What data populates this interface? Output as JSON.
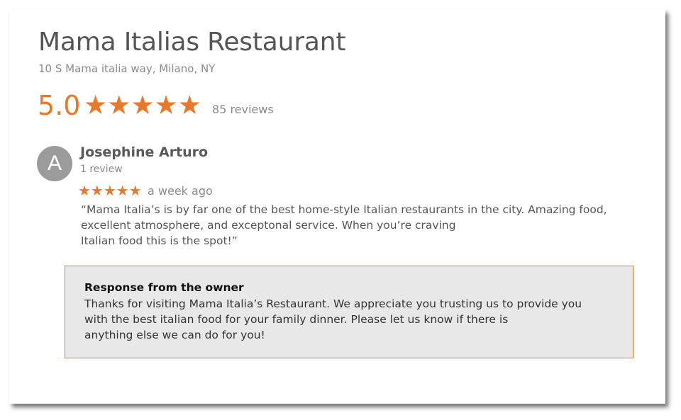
{
  "business": {
    "name": "Mama Italias Restaurant",
    "address": "10 S Mama italia way, Milano, NY"
  },
  "rating": {
    "value": "5.0",
    "stars": "★★★★★",
    "star_count": 5,
    "review_count_label": "85 reviews"
  },
  "review": {
    "avatar_letter": "A",
    "author": "Josephine Arturo",
    "author_meta": "1 review",
    "stars": "★★★★★",
    "star_count": 5,
    "time": "a week ago",
    "text_lines": [
      "“Mama Italia’s is by far one of the best home-style Italian restaurants in the city. Amazing food,",
      "excellent atmosphere, and exceptonal service. When you’re craving",
      "Italian food this is the spot!”"
    ]
  },
  "owner_response": {
    "heading": "Response from the owner",
    "text_lines": [
      "Thanks for visiting Mama Italia’s Restaurant. We appreciate you trusting us to provide you",
      "with the best italian food for your family dinner. Please let us know if there is",
      "anything else we can do for you!"
    ]
  },
  "colors": {
    "accent": "#e8782a",
    "avatar_bg": "#9b9b9b",
    "response_bg": "#e8e8e8"
  }
}
